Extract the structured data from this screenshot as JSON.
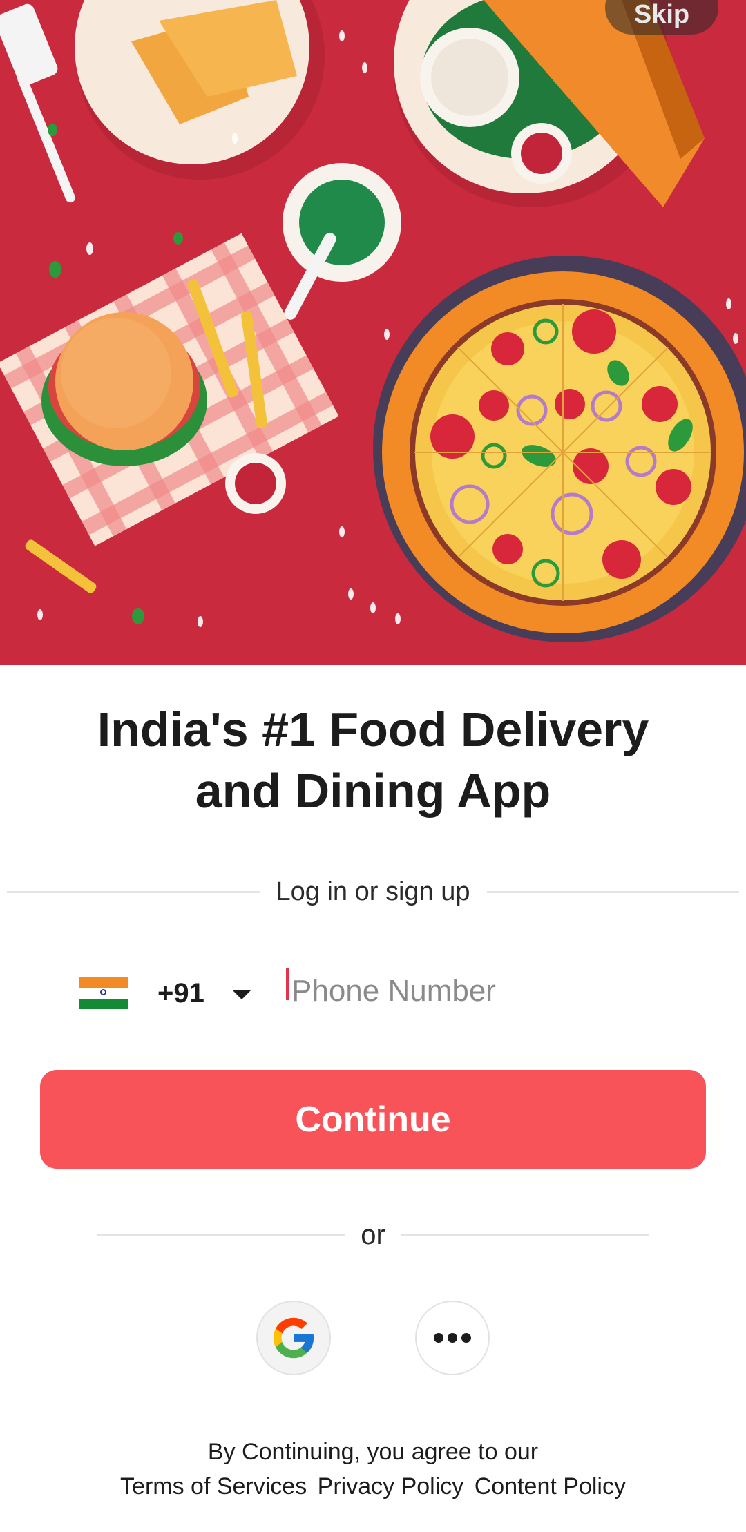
{
  "hero": {
    "skip_label": "Skip"
  },
  "headline": {
    "line1": "India's #1 Food Delivery",
    "line2": "and Dining App"
  },
  "login": {
    "divider_label": "Log in or sign up",
    "country_code": "+91",
    "flag_icon": "india-flag-icon",
    "phone_value": "",
    "phone_placeholder": "Phone Number",
    "continue_label": "Continue"
  },
  "alt_login": {
    "divider_label": "or",
    "google_icon": "google-icon",
    "more_icon": "more-options-icon"
  },
  "legal": {
    "prefix": "By Continuing, you agree to our",
    "links": [
      "Terms of Services",
      "Privacy Policy",
      "Content Policy"
    ]
  },
  "colors": {
    "brand": "#f85359",
    "hero_background": "#c92a3d",
    "text": "#1c1c1c",
    "cursor": "#e03546"
  }
}
